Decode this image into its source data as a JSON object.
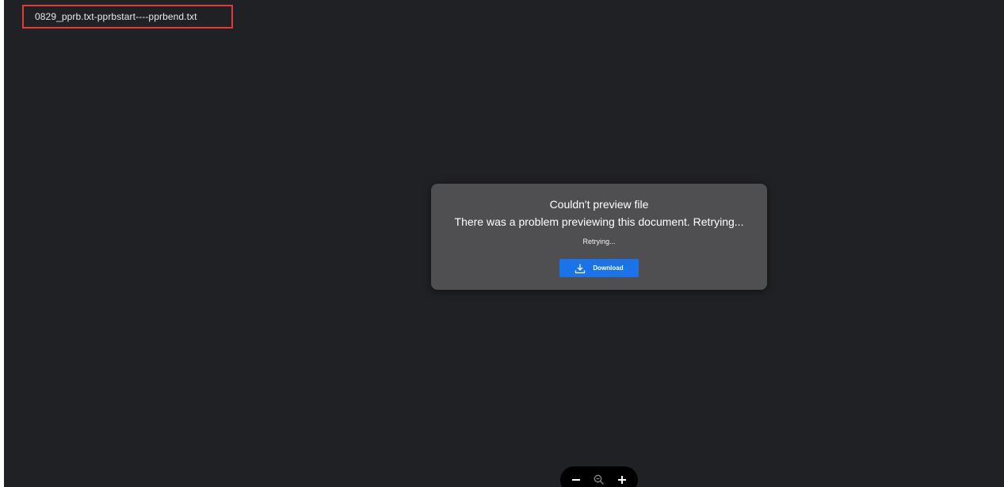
{
  "file": {
    "name": "0829_pprb.txt-pprbstart----pprbend.txt"
  },
  "dialog": {
    "title": "Couldn't preview file",
    "message": "There was a problem previewing this document. Retrying...",
    "status": "Retrying...",
    "download_label": "Download"
  },
  "zoom_controls": {
    "zoom_out_icon": "minus-icon",
    "zoom_icon": "magnifier-icon",
    "zoom_in_icon": "plus-icon"
  },
  "colors": {
    "background": "#202124",
    "dialog": "#4f4e50",
    "accent": "#1a73e8",
    "highlight_border": "#e53935"
  }
}
